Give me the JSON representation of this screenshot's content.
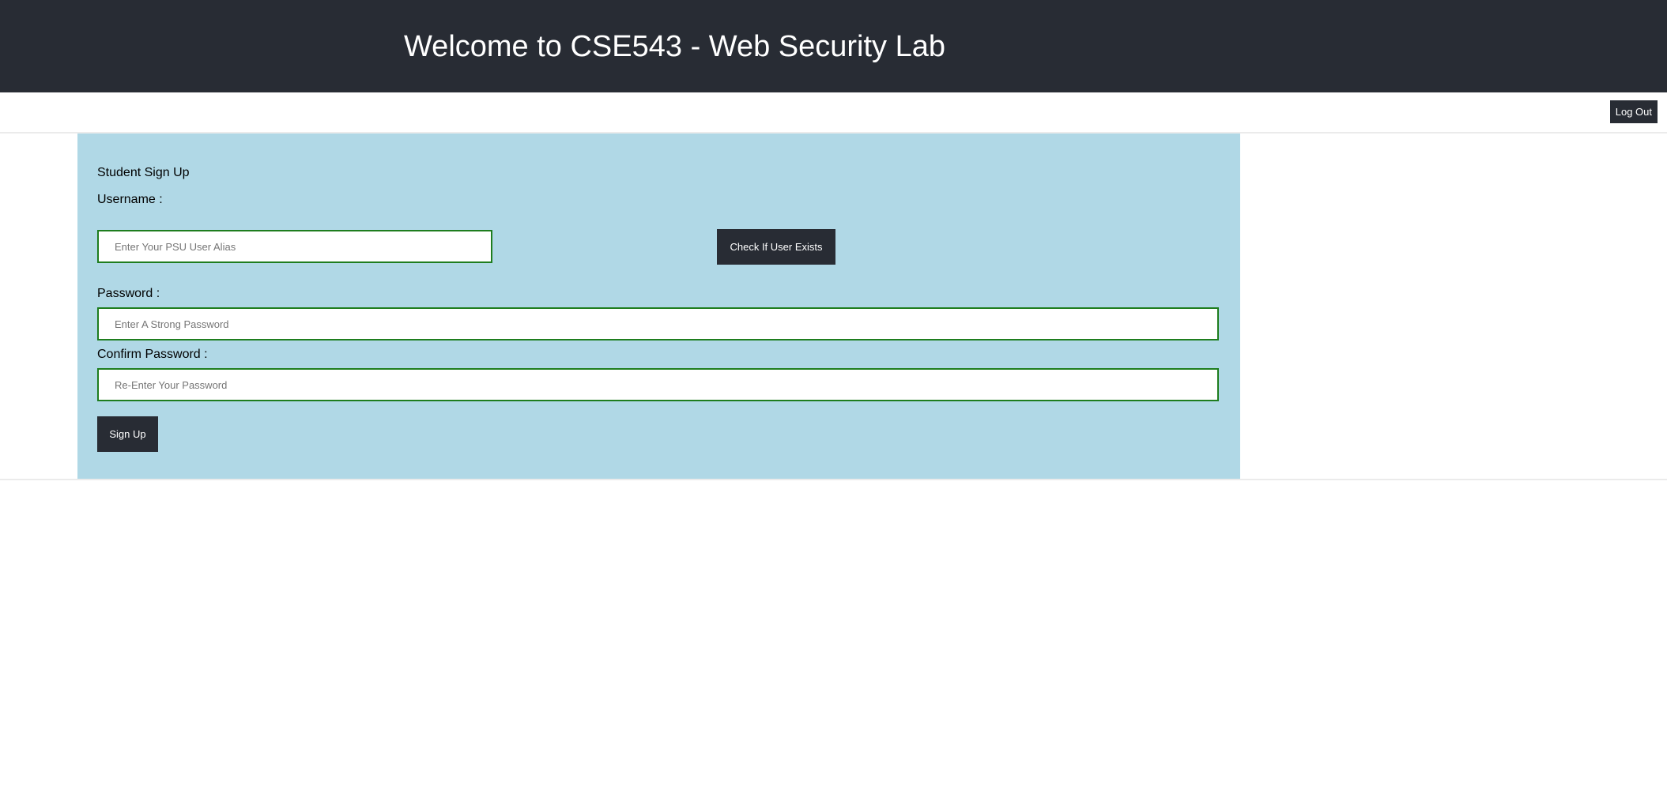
{
  "header": {
    "title": "Welcome to CSE543 - Web Security Lab"
  },
  "topbar": {
    "logout_label": "Log Out"
  },
  "signup": {
    "heading": "Student Sign Up",
    "username_label": "Username :",
    "username_placeholder": "Enter Your PSU User Alias",
    "username_value": "",
    "check_button_label": "Check If User Exists",
    "password_label": "Password :",
    "password_placeholder": "Enter A Strong Password",
    "password_value": "",
    "confirm_label": "Confirm Password :",
    "confirm_placeholder": "Re-Enter Your Password",
    "confirm_value": "",
    "submit_label": "Sign Up"
  },
  "colors": {
    "header_bg": "#282c34",
    "panel_bg": "#b0d8e6",
    "input_border": "#1e7d1e",
    "button_bg": "#282c34"
  }
}
